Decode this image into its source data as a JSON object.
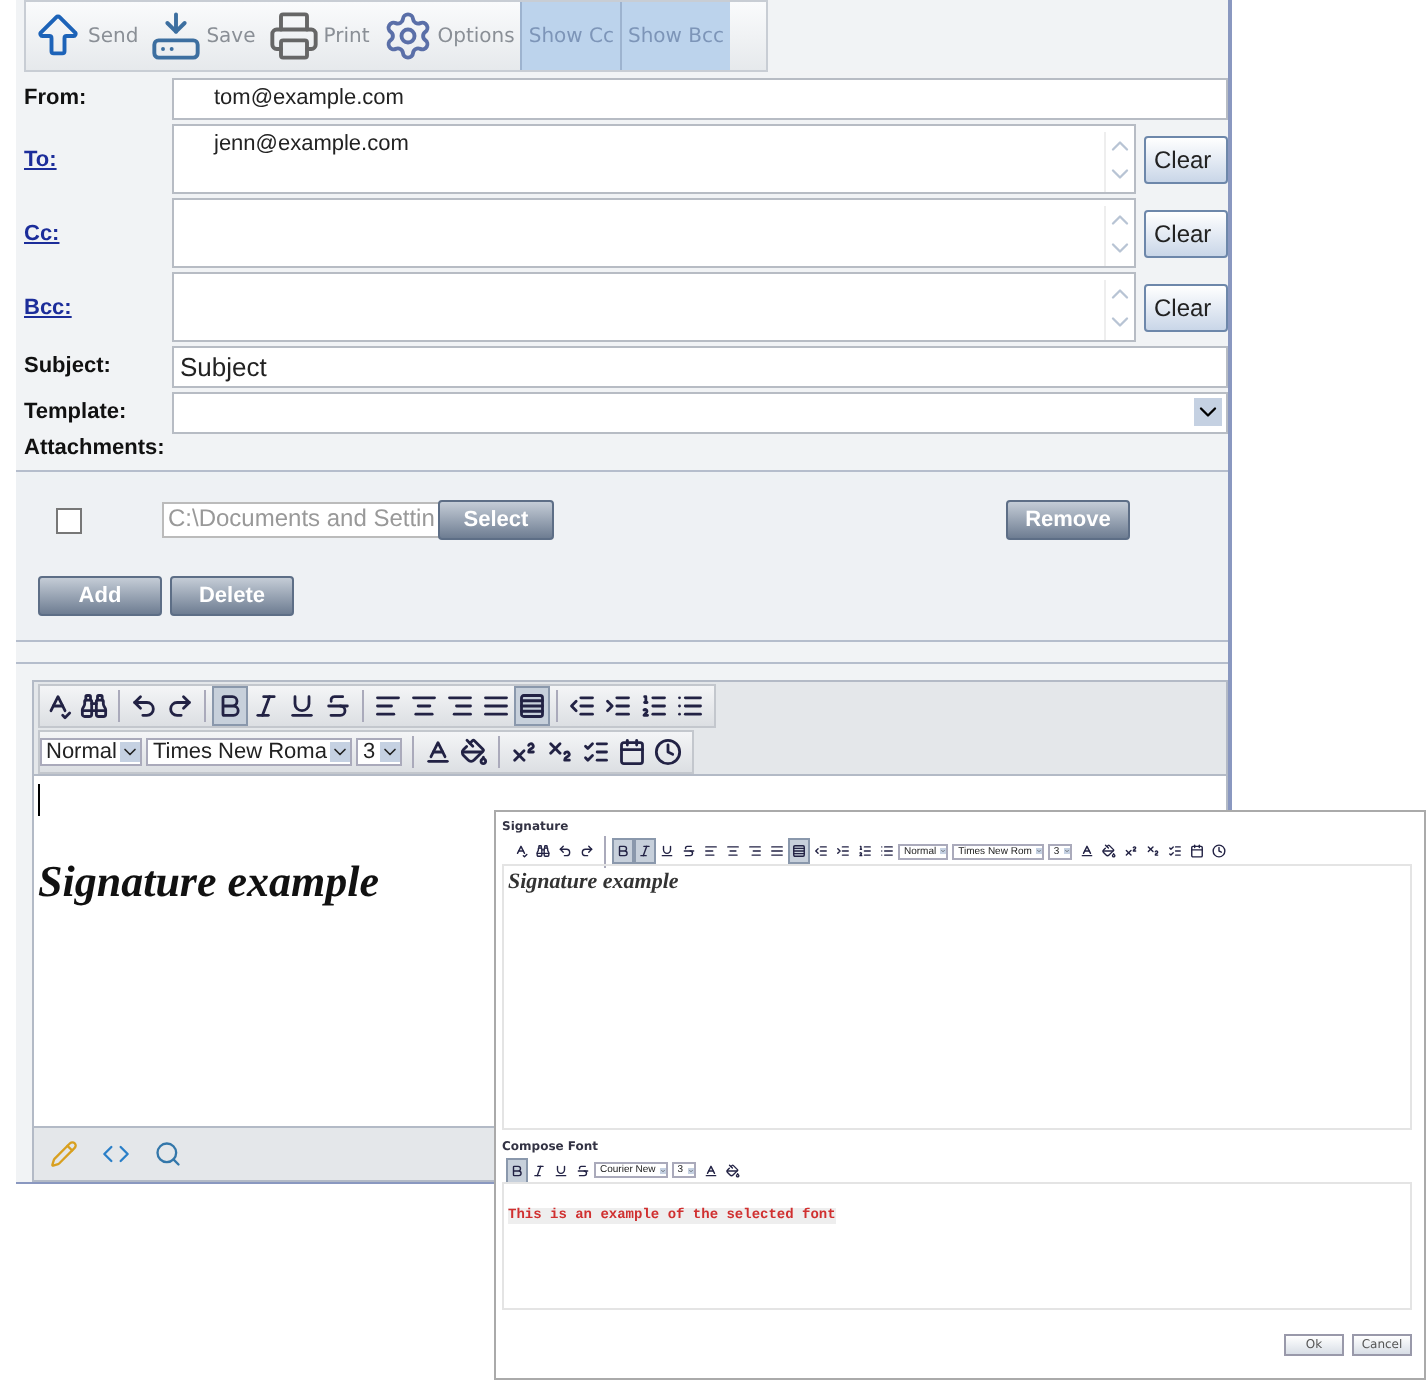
{
  "toolbar": [
    {
      "kind": "send",
      "label": "Send",
      "on": false
    },
    {
      "kind": "save",
      "label": "Save",
      "on": false
    },
    {
      "kind": "print",
      "label": "Print",
      "on": false
    },
    {
      "kind": "options",
      "label": "Options",
      "on": false
    },
    {
      "kind": "toggle",
      "label": "Show Cc",
      "on": true
    },
    {
      "kind": "toggle",
      "label": "Show Bcc",
      "on": true
    }
  ],
  "from": {
    "label": "From:",
    "value": "tom@example.com"
  },
  "recipients": [
    {
      "label": "To:",
      "value": "jenn@example.com",
      "button": "Clear"
    },
    {
      "label": "Cc:",
      "button": "Clear"
    },
    {
      "label": "Bcc:",
      "button": "Clear"
    }
  ],
  "subject": {
    "label": "Subject:",
    "value": "Subject"
  },
  "template": {
    "label": "Template:"
  },
  "attachments": {
    "label": "Attachments:",
    "checked": false,
    "path": "C:\\Documents and Settin",
    "select": "Select",
    "remove": "Remove",
    "add": "Add",
    "delete": "Delete"
  },
  "editor": {
    "rows": [
      [
        {
          "kind": "spellcheck",
          "pressed": false
        },
        {
          "kind": "find",
          "pressed": false
        },
        {
          "kind": "sep"
        },
        {
          "kind": "undo",
          "pressed": false
        },
        {
          "kind": "redo",
          "pressed": false
        },
        {
          "kind": "sep"
        },
        {
          "kind": "bold",
          "pressed": true
        },
        {
          "kind": "italic",
          "pressed": false
        },
        {
          "kind": "underline",
          "pressed": false
        },
        {
          "kind": "strike",
          "pressed": false
        },
        {
          "kind": "sep"
        },
        {
          "kind": "left",
          "pressed": false
        },
        {
          "kind": "center",
          "pressed": false
        },
        {
          "kind": "right",
          "pressed": false
        },
        {
          "kind": "justify",
          "pressed": false
        },
        {
          "kind": "block",
          "pressed": true
        },
        {
          "kind": "sep"
        },
        {
          "kind": "outdent",
          "pressed": false
        },
        {
          "kind": "indent",
          "pressed": false
        },
        {
          "kind": "ordered",
          "pressed": false
        },
        {
          "kind": "bullets",
          "pressed": false
        }
      ],
      [
        {
          "kind": "select",
          "value": "Normal"
        },
        {
          "kind": "select",
          "value": "Times New Roma"
        },
        {
          "kind": "select",
          "value": "3"
        },
        {
          "kind": "sep"
        },
        {
          "kind": "color",
          "pressed": false
        },
        {
          "kind": "fill",
          "pressed": false
        },
        {
          "kind": "sep"
        },
        {
          "kind": "sup",
          "pressed": false
        },
        {
          "kind": "sub",
          "pressed": false
        },
        {
          "kind": "rule",
          "pressed": false
        },
        {
          "kind": "date",
          "pressed": false
        },
        {
          "kind": "time",
          "pressed": false
        }
      ]
    ],
    "content": "Signature example",
    "footer": [
      {
        "kind": "pencil"
      },
      {
        "kind": "code"
      },
      {
        "kind": "zoom"
      }
    ]
  },
  "dialog": {
    "signature_title": "Signature",
    "signature_toolbar": [
      {
        "kind": "spellcheck",
        "pressed": false
      },
      {
        "kind": "find",
        "pressed": false
      },
      {
        "kind": "undo",
        "pressed": false
      },
      {
        "kind": "redo",
        "pressed": false
      },
      {
        "kind": "sep"
      },
      {
        "kind": "bold",
        "pressed": true
      },
      {
        "kind": "italic",
        "pressed": true
      },
      {
        "kind": "underline",
        "pressed": false
      },
      {
        "kind": "strike",
        "pressed": false
      },
      {
        "kind": "left",
        "pressed": false
      },
      {
        "kind": "center",
        "pressed": false
      },
      {
        "kind": "right",
        "pressed": false
      },
      {
        "kind": "justify",
        "pressed": false
      },
      {
        "kind": "block",
        "pressed": true
      },
      {
        "kind": "outdent",
        "pressed": false
      },
      {
        "kind": "indent",
        "pressed": false
      },
      {
        "kind": "ordered",
        "pressed": false
      },
      {
        "kind": "bullets",
        "pressed": false
      },
      {
        "kind": "select",
        "value": "Normal"
      },
      {
        "kind": "select",
        "value": "Times New Rom"
      },
      {
        "kind": "select",
        "value": "3"
      },
      {
        "kind": "color",
        "pressed": false
      },
      {
        "kind": "fill",
        "pressed": false
      },
      {
        "kind": "sup",
        "pressed": false
      },
      {
        "kind": "sub",
        "pressed": false
      },
      {
        "kind": "rule",
        "pressed": false
      },
      {
        "kind": "date",
        "pressed": false
      },
      {
        "kind": "time",
        "pressed": false
      }
    ],
    "signature_text": "Signature example",
    "font_title": "Compose Font",
    "font_toolbar": [
      {
        "kind": "bold",
        "pressed": true
      },
      {
        "kind": "italic",
        "pressed": false
      },
      {
        "kind": "underline",
        "pressed": false
      },
      {
        "kind": "strike",
        "pressed": false
      },
      {
        "kind": "select",
        "value": "Courier New"
      },
      {
        "kind": "select",
        "value": "3"
      },
      {
        "kind": "color",
        "pressed": false
      },
      {
        "kind": "fill",
        "pressed": false
      }
    ],
    "font_sample": "This is an example of the selected font",
    "buttons": [
      "Ok",
      "Cancel"
    ]
  }
}
